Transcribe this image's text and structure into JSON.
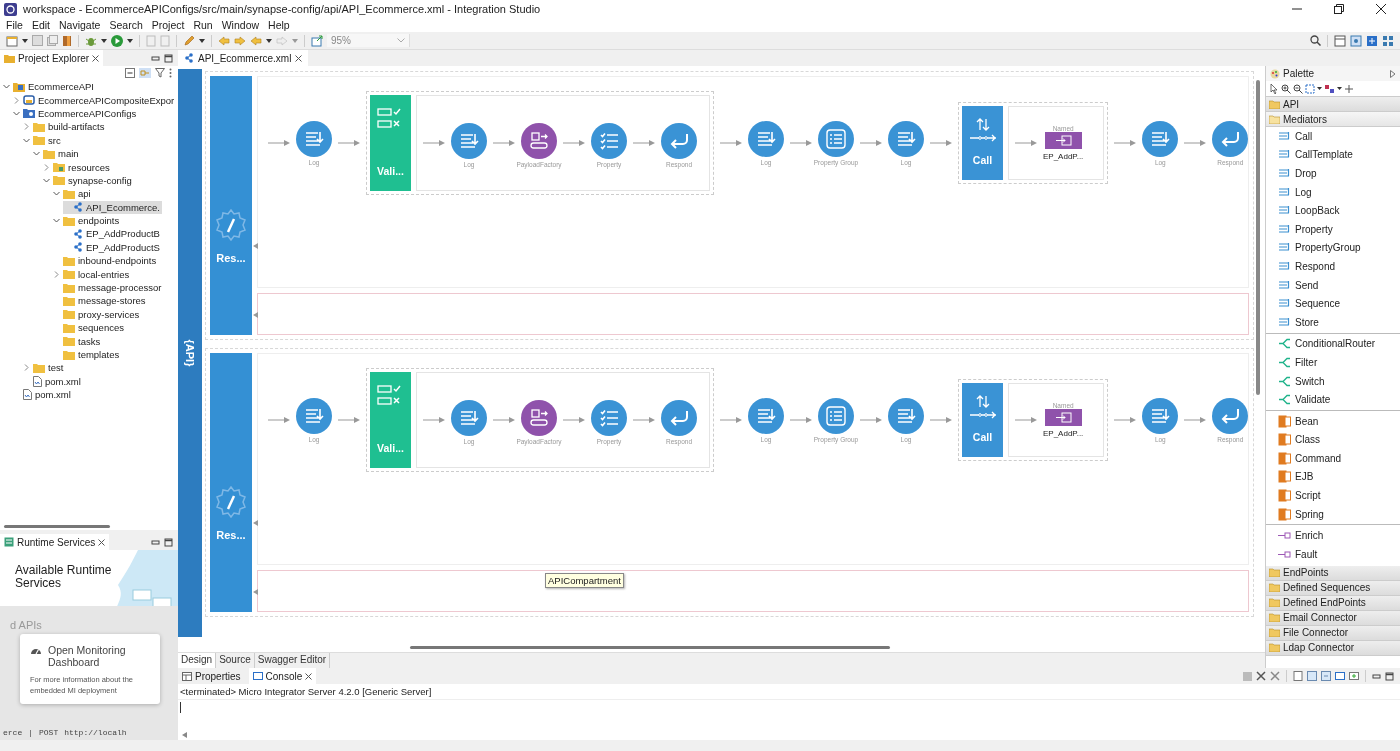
{
  "window": {
    "title": "workspace - EcommerceAPIConfigs/src/main/synapse-config/api/API_Ecommerce.xml - Integration Studio"
  },
  "menu": [
    "File",
    "Edit",
    "Navigate",
    "Search",
    "Project",
    "Run",
    "Window",
    "Help"
  ],
  "toolbar": {
    "zoom": "95%"
  },
  "project_explorer": {
    "title": "Project Explorer",
    "tree": [
      {
        "label": "EcommerceAPI",
        "kind": "project",
        "expanded": true,
        "selected": false,
        "children": [
          {
            "label": "EcommerceAPICompositeExpor",
            "kind": "composite",
            "expanded": false,
            "selected": false
          },
          {
            "label": "EcommerceAPIConfigs",
            "kind": "config",
            "expanded": true,
            "selected": false,
            "children": [
              {
                "label": "build-artifacts",
                "kind": "folder",
                "expanded": false,
                "selected": false
              },
              {
                "label": "src",
                "kind": "folder",
                "expanded": true,
                "selected": false,
                "children": [
                  {
                    "label": "main",
                    "kind": "folder",
                    "expanded": true,
                    "selected": false,
                    "children": [
                      {
                        "label": "resources",
                        "kind": "resource_folder",
                        "expanded": false,
                        "selected": false
                      },
                      {
                        "label": "synapse-config",
                        "kind": "folder",
                        "expanded": true,
                        "selected": false,
                        "children": [
                          {
                            "label": "api",
                            "kind": "folder",
                            "expanded": true,
                            "selected": false,
                            "children": [
                              {
                                "label": "API_Ecommerce.",
                                "kind": "artifact",
                                "selected": true
                              }
                            ]
                          },
                          {
                            "label": "endpoints",
                            "kind": "folder",
                            "expanded": true,
                            "selected": false,
                            "children": [
                              {
                                "label": "EP_AddProductB",
                                "kind": "artifact",
                                "selected": false
                              },
                              {
                                "label": "EP_AddProductS",
                                "kind": "artifact",
                                "selected": false
                              }
                            ]
                          },
                          {
                            "label": "inbound-endpoints",
                            "kind": "folder",
                            "selected": false
                          },
                          {
                            "label": "local-entries",
                            "kind": "folder",
                            "expanded": false,
                            "selected": false
                          },
                          {
                            "label": "message-processor",
                            "kind": "folder",
                            "selected": false
                          },
                          {
                            "label": "message-stores",
                            "kind": "folder",
                            "selected": false
                          },
                          {
                            "label": "proxy-services",
                            "kind": "folder",
                            "selected": false
                          },
                          {
                            "label": "sequences",
                            "kind": "folder",
                            "selected": false
                          },
                          {
                            "label": "tasks",
                            "kind": "folder",
                            "selected": false
                          },
                          {
                            "label": "templates",
                            "kind": "folder",
                            "selected": false
                          }
                        ]
                      }
                    ]
                  }
                ]
              },
              {
                "label": "test",
                "kind": "folder",
                "expanded": false,
                "selected": false
              },
              {
                "label": "pom.xml",
                "kind": "file",
                "selected": false
              }
            ]
          },
          {
            "label": "pom.xml",
            "kind": "file",
            "selected": false
          }
        ]
      }
    ]
  },
  "runtime_services": {
    "title": "Runtime Services",
    "heading": "Available Runtime Services",
    "partial_heading": "d APIs",
    "card": {
      "title": "Open Monitoring Dashboard",
      "text": "For more information about the embedded MI deployment"
    },
    "row": [
      "erce",
      "|",
      "POST",
      "http://localh"
    ]
  },
  "editor": {
    "tabs": [
      {
        "label": "API_Ecommerce.xml",
        "selected": true
      }
    ],
    "api_badge": "{API}",
    "tooltip": "APICompartment",
    "resources": [
      {
        "label": "Res...",
        "flow": [
          {
            "kind": "log",
            "label": "Log"
          },
          {
            "kind": "validate",
            "label": "Vali...",
            "children": [
              {
                "kind": "log",
                "label": "Log"
              },
              {
                "kind": "payload_factory",
                "label": "PayloadFactory"
              },
              {
                "kind": "property",
                "label": "Property"
              },
              {
                "kind": "respond",
                "label": "Respond"
              }
            ]
          },
          {
            "kind": "log",
            "label": "Log"
          },
          {
            "kind": "property_group",
            "label": "Property Group"
          },
          {
            "kind": "log",
            "label": "Log"
          },
          {
            "kind": "call",
            "label": "Call",
            "children": [
              {
                "kind": "endpoint",
                "caption": "Named",
                "label": "EP_AddP..."
              }
            ]
          },
          {
            "kind": "log",
            "label": "Log"
          },
          {
            "kind": "respond",
            "label": "Respond"
          }
        ]
      },
      {
        "label": "Res...",
        "flow": [
          {
            "kind": "log",
            "label": "Log"
          },
          {
            "kind": "validate",
            "label": "Vali...",
            "children": [
              {
                "kind": "log",
                "label": "Log"
              },
              {
                "kind": "payload_factory",
                "label": "PayloadFactory"
              },
              {
                "kind": "property",
                "label": "Property"
              },
              {
                "kind": "respond",
                "label": "Respond"
              }
            ]
          },
          {
            "kind": "log",
            "label": "Log"
          },
          {
            "kind": "property_group",
            "label": "Property Group"
          },
          {
            "kind": "log",
            "label": "Log"
          },
          {
            "kind": "call",
            "label": "Call",
            "children": [
              {
                "kind": "endpoint",
                "caption": "Named",
                "label": "EP_AddP..."
              }
            ]
          },
          {
            "kind": "log",
            "label": "Log"
          },
          {
            "kind": "respond",
            "label": "Respond"
          }
        ]
      }
    ],
    "bottom_tabs": [
      {
        "label": "Design",
        "selected": true
      },
      {
        "label": "Source",
        "selected": false
      },
      {
        "label": "Swagger Editor",
        "selected": false
      }
    ]
  },
  "palette": {
    "title": "Palette",
    "drawers": [
      {
        "label": "API",
        "expanded": false
      },
      {
        "label": "Mediators",
        "expanded": true,
        "groups": [
          {
            "kind": "core",
            "items": [
              "Call",
              "CallTemplate",
              "Drop",
              "Log",
              "LoopBack",
              "Property",
              "PropertyGroup",
              "Respond",
              "Send",
              "Sequence",
              "Store"
            ]
          },
          {
            "kind": "filter",
            "items": [
              "ConditionalRouter",
              "Filter",
              "Switch",
              "Validate"
            ]
          },
          {
            "kind": "extension",
            "items": [
              "Bean",
              "Class",
              "Command",
              "EJB",
              "Script",
              "Spring"
            ]
          },
          {
            "kind": "transform",
            "items": [
              "Enrich",
              "Fault"
            ]
          }
        ]
      },
      {
        "label": "EndPoints",
        "expanded": false
      },
      {
        "label": "Defined Sequences",
        "expanded": false
      },
      {
        "label": "Defined EndPoints",
        "expanded": false
      },
      {
        "label": "Email Connector",
        "expanded": false
      },
      {
        "label": "File Connector",
        "expanded": false
      },
      {
        "label": "Ldap Connector",
        "expanded": false
      }
    ]
  },
  "console": {
    "tabs": [
      {
        "label": "Properties",
        "selected": false
      },
      {
        "label": "Console",
        "selected": true
      }
    ],
    "line": "<terminated> Micro Integrator Server 4.2.0 [Generic Server]"
  }
}
